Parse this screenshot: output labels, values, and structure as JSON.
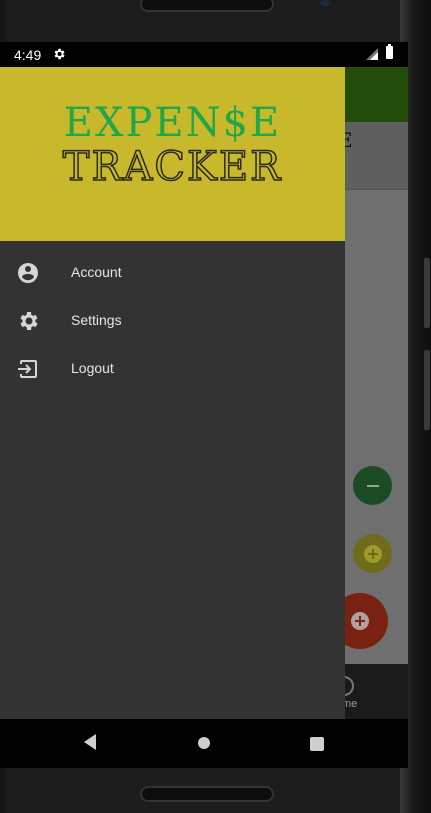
{
  "status_bar": {
    "time": "4:49"
  },
  "drawer": {
    "logo_line1": "EXPEN$E",
    "logo_line2": "TRACKER",
    "items": [
      {
        "label": "Account",
        "icon": "account-circle-icon"
      },
      {
        "label": "Settings",
        "icon": "gear-icon"
      },
      {
        "label": "Logout",
        "icon": "logout-icon"
      }
    ]
  },
  "background_app": {
    "header_text": "E",
    "bottom_nav_label": "me"
  },
  "colors": {
    "drawer_bg": "#333333",
    "header_yellow": "#c8b82c",
    "logo_green": "#22a64a",
    "toolbar_green": "#244c0b"
  }
}
